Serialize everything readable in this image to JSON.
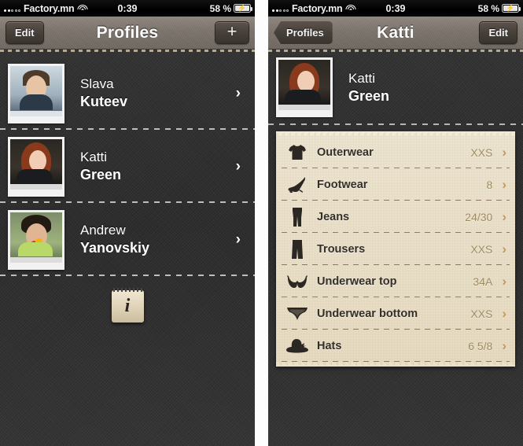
{
  "statusbar": {
    "carrier": "Factory.mn",
    "time": "0:39",
    "battery_percent": "58 %",
    "signal_icon": "signal-bars-icon",
    "wifi_icon": "wifi-icon",
    "battery_icon": "battery-charging-icon"
  },
  "left_screen": {
    "navbar": {
      "left_button": "Edit",
      "title": "Profiles",
      "right_button": "+"
    },
    "profiles": [
      {
        "first": "Slava",
        "last": "Kuteev",
        "photo": "portrait-slava"
      },
      {
        "first": "Katti",
        "last": "Green",
        "photo": "portrait-katti"
      },
      {
        "first": "Andrew",
        "last": "Yanovskiy",
        "photo": "portrait-andrew"
      }
    ],
    "info_button_label": "i"
  },
  "right_screen": {
    "navbar": {
      "back_button": "Profiles",
      "title": "Katti",
      "right_button": "Edit"
    },
    "person": {
      "first": "Katti",
      "last": "Green",
      "photo": "portrait-katti"
    },
    "items": [
      {
        "icon": "tshirt-icon",
        "label": "Outerwear",
        "value": "XXS"
      },
      {
        "icon": "high-heel-shoe-icon",
        "label": "Footwear",
        "value": "8"
      },
      {
        "icon": "jeans-icon",
        "label": "Jeans",
        "value": "24/30"
      },
      {
        "icon": "trousers-icon",
        "label": "Trousers",
        "value": "XXS"
      },
      {
        "icon": "bra-icon",
        "label": "Underwear top",
        "value": "34A"
      },
      {
        "icon": "panties-icon",
        "label": "Underwear bottom",
        "value": "XXS"
      },
      {
        "icon": "hat-icon",
        "label": "Hats",
        "value": "6 5/8"
      }
    ]
  },
  "colors": {
    "background": "#2e2e2e",
    "navbar": "#7b736b",
    "card": "#ece0c6",
    "chevron_tan": "#c29a5e",
    "value_text": "#a08c63"
  },
  "chevron_glyph": "›"
}
